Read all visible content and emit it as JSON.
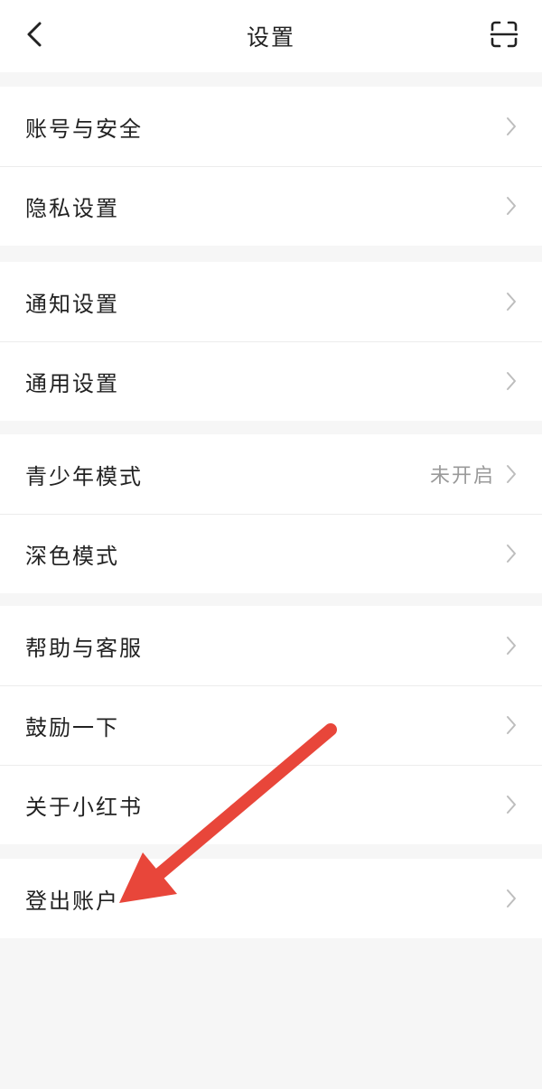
{
  "header": {
    "title": "设置",
    "back_icon": "chevron-left-icon",
    "scan_icon": "scan-icon"
  },
  "sections": [
    {
      "items": [
        {
          "label": "账号与安全"
        },
        {
          "label": "隐私设置"
        }
      ]
    },
    {
      "items": [
        {
          "label": "通知设置"
        },
        {
          "label": "通用设置"
        }
      ]
    },
    {
      "items": [
        {
          "label": "青少年模式",
          "value": "未开启"
        },
        {
          "label": "深色模式"
        }
      ]
    },
    {
      "items": [
        {
          "label": "帮助与客服"
        },
        {
          "label": "鼓励一下"
        },
        {
          "label": "关于小红书"
        }
      ]
    },
    {
      "items": [
        {
          "label": "登出账户"
        }
      ]
    }
  ],
  "colors": {
    "background": "#f6f6f6",
    "card": "#ffffff",
    "text": "#222222",
    "secondary_text": "#9a9a9a",
    "chevron": "#bdbdbd",
    "annotation_arrow": "#e8463a"
  }
}
